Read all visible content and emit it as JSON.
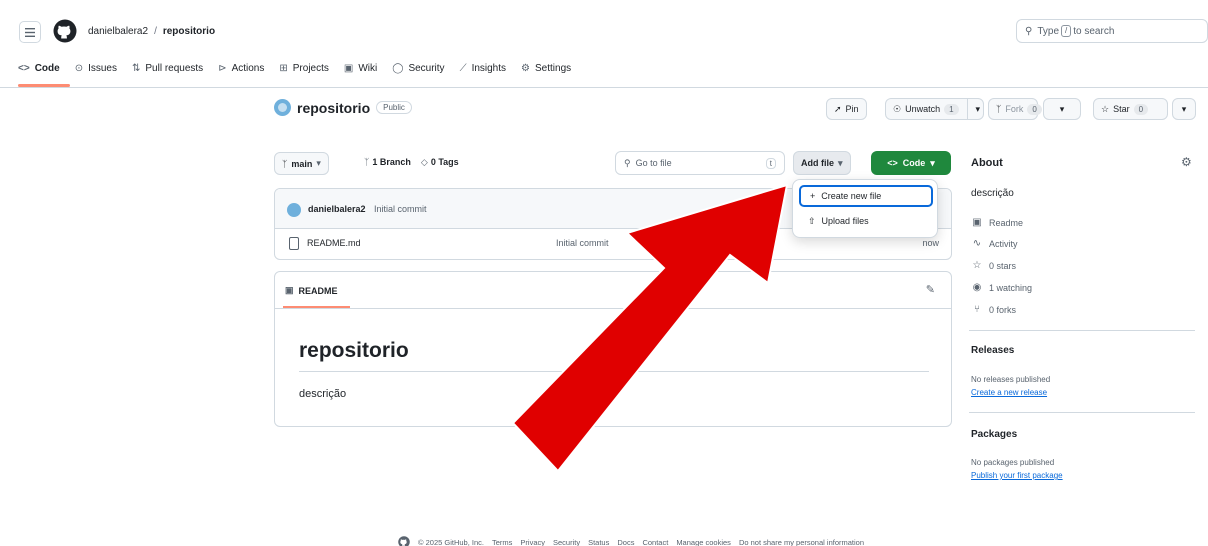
{
  "header": {
    "owner": "danielbalera2",
    "separator": "/",
    "repo": "repositorio",
    "search_prefix": "Type",
    "search_key": "/",
    "search_suffix": "to search"
  },
  "tabs": [
    {
      "label": "Code",
      "icon": "<>"
    },
    {
      "label": "Issues",
      "icon": "⊙"
    },
    {
      "label": "Pull requests",
      "icon": "⇅"
    },
    {
      "label": "Actions",
      "icon": "⊳"
    },
    {
      "label": "Projects",
      "icon": "⊞"
    },
    {
      "label": "Wiki",
      "icon": "📖"
    },
    {
      "label": "Security",
      "icon": "⓪"
    },
    {
      "label": "Insights",
      "icon": "⟋"
    },
    {
      "label": "Settings",
      "icon": "⚙"
    }
  ],
  "repo_header": {
    "name": "repositorio",
    "visibility": "Public",
    "pin_label": "Pin",
    "unwatch_label": "Unwatch",
    "unwatch_count": "1",
    "fork_label": "Fork",
    "fork_count": "0",
    "star_label": "Star",
    "star_count": "0"
  },
  "toolbar": {
    "branch": "main",
    "branches": "1 Branch",
    "tags": "0 Tags",
    "go_to_file": "Go to file",
    "go_to_file_key": "t",
    "add_file": "Add file",
    "code": "Code"
  },
  "add_file_menu": {
    "items": [
      "Create new file",
      "Upload files"
    ],
    "item_icons": [
      "+",
      "⇧"
    ]
  },
  "commit": {
    "author": "danielbalera2",
    "message": "Initial commit"
  },
  "files": [
    {
      "name": "README.md",
      "message": "Initial commit",
      "time": "now"
    }
  ],
  "readme": {
    "tab_label": "README",
    "heading": "repositorio",
    "body": "descrição"
  },
  "about": {
    "title": "About",
    "description": "descrição",
    "items": [
      {
        "icon": "📖",
        "label": "Readme"
      },
      {
        "icon": "∿",
        "label": "Activity"
      },
      {
        "icon": "☆",
        "label": "0 stars"
      },
      {
        "icon": "◉",
        "label": "1 watching"
      },
      {
        "icon": "⑂",
        "label": "0 forks"
      }
    ],
    "releases_title": "Releases",
    "releases_text": "No releases published",
    "releases_link": "Create a new release",
    "packages_title": "Packages",
    "packages_text": "No packages published",
    "packages_link": "Publish your first package"
  },
  "footer": {
    "copyright": "© 2025 GitHub, Inc.",
    "links": [
      "Terms",
      "Privacy",
      "Security",
      "Status",
      "Docs",
      "Contact",
      "Manage cookies",
      "Do not share my personal information"
    ]
  },
  "colors": {
    "accent_green": "#1f883d",
    "tab_underline": "#fd8c73",
    "link_blue": "#0969da",
    "arrow_red": "#e00000"
  }
}
